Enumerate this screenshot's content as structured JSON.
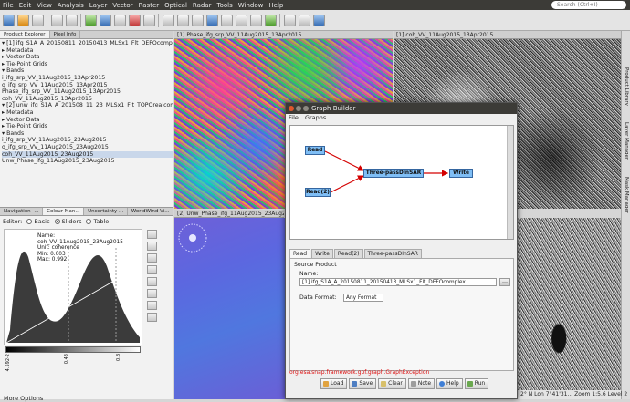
{
  "menu": {
    "items": [
      "File",
      "Edit",
      "View",
      "Analysis",
      "Layer",
      "Vector",
      "Raster",
      "Optical",
      "Radar",
      "Tools",
      "Window",
      "Help"
    ],
    "search_placeholder": "Search (Ctrl+I)"
  },
  "left": {
    "tabs": [
      "Product Explorer",
      "Pixel Info"
    ],
    "tree": [
      {
        "text": "▾ [1] ifg_S1A_A_20150811_20150413_MLSx1_Flt_DEFOcomplex"
      },
      {
        "text": "   ▸ Metadata"
      },
      {
        "text": "   ▸ Vector Data"
      },
      {
        "text": "   ▸ Tie-Point Grids"
      },
      {
        "text": "   ▾ Bands"
      },
      {
        "text": "        i_ifg_srp_VV_11Aug2015_13Apr2015"
      },
      {
        "text": "        q_ifg_srp_VV_11Aug2015_13Apr2015"
      },
      {
        "text": "        Phase_ifg_srp_VV_11Aug2015_13Apr2015"
      },
      {
        "text": "        coh_VV_11Aug2015_13Apr2015"
      },
      {
        "text": "▾ [2] unw_ifg_S1A_A_201508_11_23_MLSx1_Flt_TOPOrealcomplex"
      },
      {
        "text": "   ▸ Metadata"
      },
      {
        "text": "   ▸ Vector Data"
      },
      {
        "text": "   ▸ Tie-Point Grids"
      },
      {
        "text": "   ▾ Bands"
      },
      {
        "text": "        i_ifg_srp_VV_11Aug2015_23Aug2015"
      },
      {
        "text": "        q_ifg_srp_VV_11Aug2015_23Aug2015"
      },
      {
        "text": "        coh_VV_11Aug2015_23Aug2015",
        "selected": true
      },
      {
        "text": "        Unw_Phase_ifg_11Aug2015_23Aug2015"
      }
    ],
    "bottom_tabs": [
      "Navigation -...",
      "Colour Man...",
      "Uncertainty ...",
      "WorldWind Vi..."
    ],
    "editor": {
      "label": "Editor:",
      "options": [
        "Basic",
        "Sliders",
        "Table"
      ],
      "selected": "Sliders"
    },
    "hist_info": [
      "Name: coh_VV_11Aug2015_23Aug2015",
      "Unit: coherence",
      "Min: 0.003",
      "Max: 0.992"
    ],
    "gradient_labels": [
      "4.592-2",
      "0.43",
      "0.8"
    ],
    "more_options": "More Options"
  },
  "views": [
    {
      "title": "[1] Phase_ifg_srp_VV_11Aug2015_13Apr2015"
    },
    {
      "title": "[1] coh_VV_11Aug2015_13Apr2015"
    },
    {
      "title": "[2] Unw_Phase_ifg_11Aug2015_23Aug2015"
    }
  ],
  "right_tabs": [
    "Product Library",
    "Layer Manager",
    "Mask Manager"
  ],
  "status": "2° N Lon 7°41'31...  Zoom 1:5.6  Level 2",
  "graph_builder": {
    "title": "Graph Builder",
    "menu": [
      "File",
      "Graphs"
    ],
    "nodes": [
      "Read",
      "Read(2)",
      "Three-passDInSAR",
      "Write"
    ],
    "tabs": [
      "Read",
      "Write",
      "Read(2)",
      "Three-passDInSAR"
    ],
    "source_product_label": "Source Product",
    "name_label": "Name:",
    "name_value": "[1] ifg_S1A_A_20150811_20150413_MLSx1_Flt_DEFOcomplex",
    "data_format_label": "Data Format:",
    "data_format_value": "Any Format",
    "error": "org.esa.snap.framework.gpf.graph.GraphException",
    "buttons": [
      "Load",
      "Save",
      "Clear",
      "Note",
      "Help",
      "Run"
    ]
  },
  "colors": {
    "accent": "#3566a0",
    "arrow": "#d40000",
    "titlebar": "#3c3b37"
  }
}
